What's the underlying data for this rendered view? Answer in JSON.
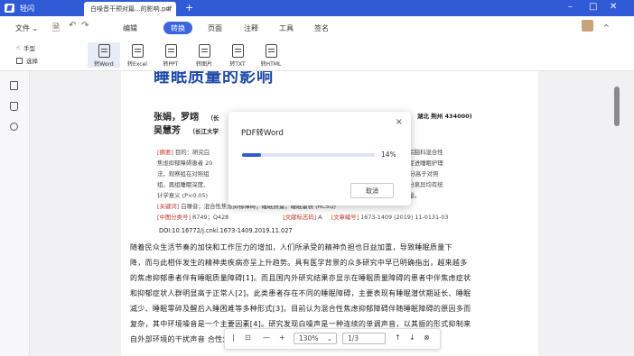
{
  "app": {
    "name": "轻闪",
    "tab_title": "白噪音干预对篇...的影响.pdf",
    "tab_close": "×",
    "new_tab": "+",
    "win_min": "–",
    "win_max": "□",
    "win_close": "✕"
  },
  "menu": {
    "file": "文件",
    "items": [
      "编辑",
      "转换",
      "页面",
      "注释",
      "工具",
      "签名"
    ],
    "active": "转换",
    "collapse": "^"
  },
  "toolbar": {
    "hand": "手型",
    "select": "选择",
    "tools": [
      "转Word",
      "转Excel",
      "转PPT",
      "转图片",
      "转TXT",
      "转HTML"
    ]
  },
  "doc": {
    "title": "睡眠质量的影响",
    "author1": "张娟，罗翊",
    "author1_aff": "（长",
    "author1_aff_right": "湖北 荆州 434000)",
    "author2": "吴慧芳",
    "author2_aff": "（长江大学",
    "abstract_lines": [
      {
        "a": "[摘要]",
        "b": " 目的：研究白",
        "c": "方法：选择医院脑科混合性"
      },
      {
        "a": "",
        "b": "焦虑抑郁障碍患者 20",
        "c": "对照组行常规促进睡眠护理"
      },
      {
        "a": "",
        "b": "法，观察组在对照组",
        "c": "表 (RCSQ) 评分高于对照"
      },
      {
        "a": "",
        "b": "组，再组睡眠深度、",
        "c": "对环境噪音再分泉异均有统"
      },
      {
        "a": "",
        "b": "计学意义 (P<0.05)",
        "c": "患者的睡眠质量。"
      }
    ],
    "keywords_label": "[关键词]",
    "keywords": " 白噪音；混合性焦虑抑郁障碍；睡眠质量；睡眠量表 (RCSQ)",
    "cls_label": "[中图分类号]",
    "cls": " R749；Q428",
    "doc_code_label": "[文献标志码]",
    "doc_code": " A",
    "article_label": "[文章编号]",
    "article": " 1673-1409 (2019) 11-0131-03",
    "doi": "DOI:10.16772/j.cnki.1673-1409.2019.11.027",
    "body": [
      "    随着民众生活节奏的加快和工作压力的增加，人们所承受的精神负担也日益加重，导致睡眠质量下",
      "降，而与此相伴发生的精神类疾病亦呈上升趋势。具有医学背景的众多研究中早已明确指出，越来越多",
      "的焦虑抑郁患者伴有睡眠质量障碍[1]。而且国内外研究结果亦显示在睡眠质量障碍的患者中伴焦虑症状",
      "和抑郁症状人群明显高于正常人[2]。此类患者存在不同的睡眠障碍，主要表现有睡眠潜伏期延长、睡眠",
      "减少、睡眠零碎及醒后入睡困难等多种形式[3]。目前认为混合性焦虑抑郁障碍伴随睡眠障碍的原因多而",
      "复杂，其中环境噪音是一个主要因素[4]。研究发现白噪声是一种连续的单调声音，以其振的形式抑制来",
      "自外部环境的干扰声音                                                                            合性焦虑抑郁障碍患者"
    ]
  },
  "dialog": {
    "title": "PDF转Word",
    "close": "×",
    "progress": 0.14,
    "percent": "14%",
    "cancel": "取消"
  },
  "zoom": {
    "value": "130%",
    "page": "1/3"
  },
  "colors": {
    "titlebar": "#2f5bd6",
    "accent": "#3a66de",
    "title_text": "#1f4aa8",
    "red_label": "#c0392b"
  }
}
